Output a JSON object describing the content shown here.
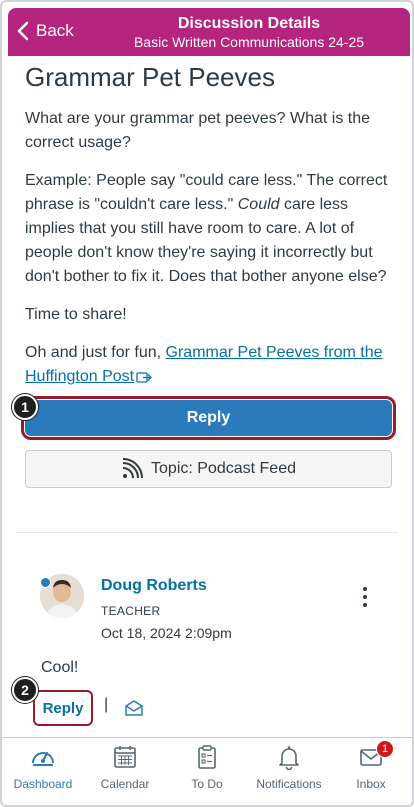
{
  "header": {
    "back_label": "Back",
    "title": "Discussion Details",
    "subtitle": "Basic Written Communications 24-25",
    "color": "#b5247f"
  },
  "discussion": {
    "title": "Grammar Pet Peeves",
    "paragraph1": "What are your grammar pet peeves? What is the correct usage?",
    "paragraph2_before": "Example: People say \"could care less.\" The correct phrase is \"couldn't care less.\" ",
    "paragraph2_em": "Could",
    "paragraph2_after": " care less implies that you still have room to care. A lot of people don't know they're saying it incorrectly but don't bother to fix it. Does that bother anyone else?",
    "paragraph3": "Time to share!",
    "paragraph4_prefix": "Oh and just for fun, ",
    "link_text": "Grammar Pet Peeves from the Huffington Post",
    "link_icon": "external-link-icon"
  },
  "actions": {
    "reply_label": "Reply",
    "podcast_label": "Topic: Podcast Feed",
    "podcast_icon": "rss-icon"
  },
  "callouts": [
    "1",
    "2"
  ],
  "comment": {
    "author": "Doug Roberts",
    "role": "TEACHER",
    "date": "Oct 18, 2024 2:09pm",
    "text": "Cool!",
    "reply_label": "Reply",
    "separator": "|",
    "mark_icon": "mark-read-icon"
  },
  "tabbar": {
    "items": [
      {
        "label": "Dashboard",
        "icon": "dashboard-icon",
        "active": true
      },
      {
        "label": "Calendar",
        "icon": "calendar-icon",
        "active": false
      },
      {
        "label": "To Do",
        "icon": "todo-icon",
        "active": false
      },
      {
        "label": "Notifications",
        "icon": "bell-icon",
        "active": false
      },
      {
        "label": "Inbox",
        "icon": "inbox-icon",
        "active": false,
        "badge": "1"
      }
    ]
  },
  "colors": {
    "primary": "#2b7abc",
    "link": "#0770a3",
    "callout_outline": "#9a1b2a",
    "badge": "#d01a19"
  }
}
